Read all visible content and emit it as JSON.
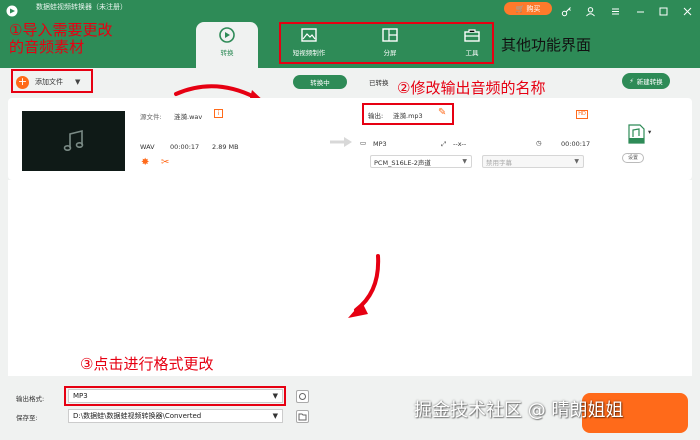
{
  "app": {
    "title": "数据蛙视频转换器（未注册）",
    "buy_label": "购买"
  },
  "tabs": [
    {
      "label": "转换",
      "icon": "convert-icon",
      "active": true
    },
    {
      "label": "短视频制作",
      "icon": "image-icon",
      "active": false
    },
    {
      "label": "分屏",
      "icon": "split-screen-icon",
      "active": false
    },
    {
      "label": "工具",
      "icon": "toolbox-icon",
      "active": false
    }
  ],
  "toolbar": {
    "add_file_label": "添加文件",
    "converting_label": "转换中",
    "converted_label": "已转换",
    "new_convert_label": "新建转换"
  },
  "file": {
    "source_label": "源文件:",
    "source_name": "涟漪.wav",
    "format": "WAV",
    "duration": "00:00:17",
    "size": "2.89 MB",
    "output_label": "输出:",
    "output_name": "涟漪.mp3",
    "out_format": "MP3",
    "out_resolution": "--x--",
    "out_duration": "00:00:17",
    "audio_track": "PCM_S16LE-2声道",
    "subtitle": "禁用字幕",
    "hd_badge": "HD",
    "settings_label": "设置"
  },
  "bottom": {
    "output_format_label": "输出格式:",
    "output_format_value": "MP3",
    "save_to_label": "保存至:",
    "save_to_path": "D:\\数据蛙\\数据蛙视频转换器\\Converted"
  },
  "annotations": {
    "step1": "①导入需要更改\n的音频素材",
    "step2": "②修改输出音频的名称",
    "step3": "③点击进行格式更改",
    "other": "其他功能界面"
  },
  "watermark": "掘金技术社区 @ 晴朗姐姐",
  "colors": {
    "brand_green": "#2e8b57",
    "accent_orange": "#ff6a1a",
    "annotation_red": "#e60012"
  }
}
